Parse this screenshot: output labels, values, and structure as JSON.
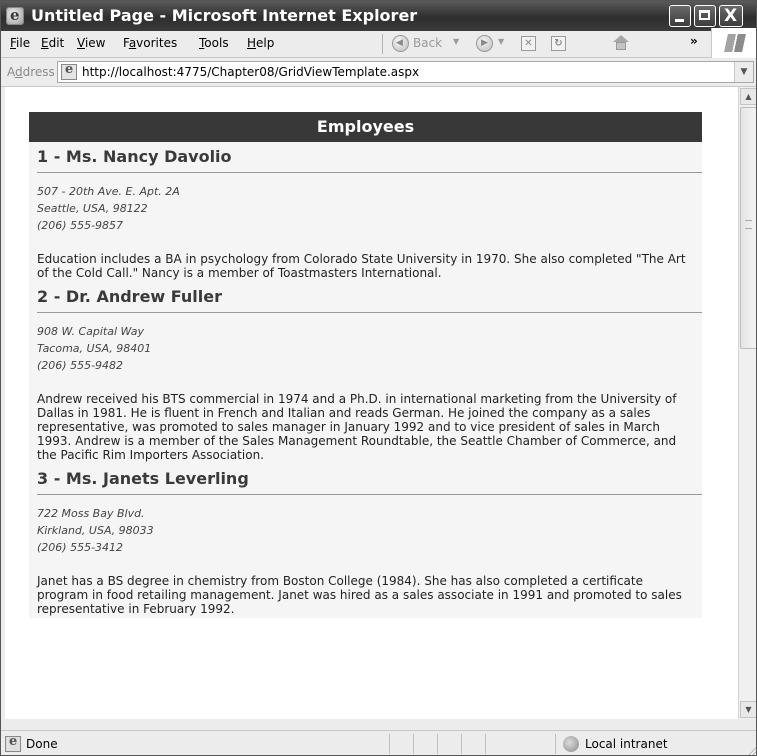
{
  "window": {
    "title": "Untitled Page - Microsoft Internet Explorer",
    "close_glyph": "X"
  },
  "menu": {
    "items": [
      "File",
      "Edit",
      "View",
      "Favorites",
      "Tools",
      "Help"
    ],
    "accelerators": [
      "F",
      "E",
      "V",
      "a",
      "T",
      "H"
    ]
  },
  "toolbar": {
    "back_label": "Back",
    "more_glyph": "»",
    "stop_glyph": "✕",
    "refresh_glyph": "↻"
  },
  "address": {
    "label": "Address",
    "url": "http://localhost:4775/Chapter08/GridViewTemplate.aspx"
  },
  "grid": {
    "header": "Employees",
    "employees": [
      {
        "name": "1 - Ms. Nancy Davolio",
        "address": "507 - 20th Ave. E. Apt. 2A",
        "city_line": "Seattle, USA, 98122",
        "phone": "(206) 555-9857",
        "notes": "Education includes a BA in psychology from Colorado State University in 1970. She also completed \"The Art of the Cold Call.\" Nancy is a member of Toastmasters International."
      },
      {
        "name": "2 - Dr. Andrew Fuller",
        "address": "908 W. Capital Way",
        "city_line": "Tacoma, USA, 98401",
        "phone": "(206) 555-9482",
        "notes": "Andrew received his BTS commercial in 1974 and a Ph.D. in international marketing from the University of Dallas in 1981. He is fluent in French and Italian and reads German. He joined the company as a sales representative, was promoted to sales manager in January 1992 and to vice president of sales in March 1993. Andrew is a member of the Sales Management Roundtable, the Seattle Chamber of Commerce, and the Pacific Rim Importers Association."
      },
      {
        "name": "3 - Ms. Janets Leverling",
        "address": "722 Moss Bay Blvd.",
        "city_line": "Kirkland, USA, 98033",
        "phone": "(206) 555-3412",
        "notes": "Janet has a BS degree in chemistry from Boston College (1984). She has also completed a certificate program in food retailing management. Janet was hired as a sales associate in 1991 and promoted to sales representative in February 1992."
      }
    ]
  },
  "status": {
    "text": "Done",
    "zone": "Local intranet"
  }
}
